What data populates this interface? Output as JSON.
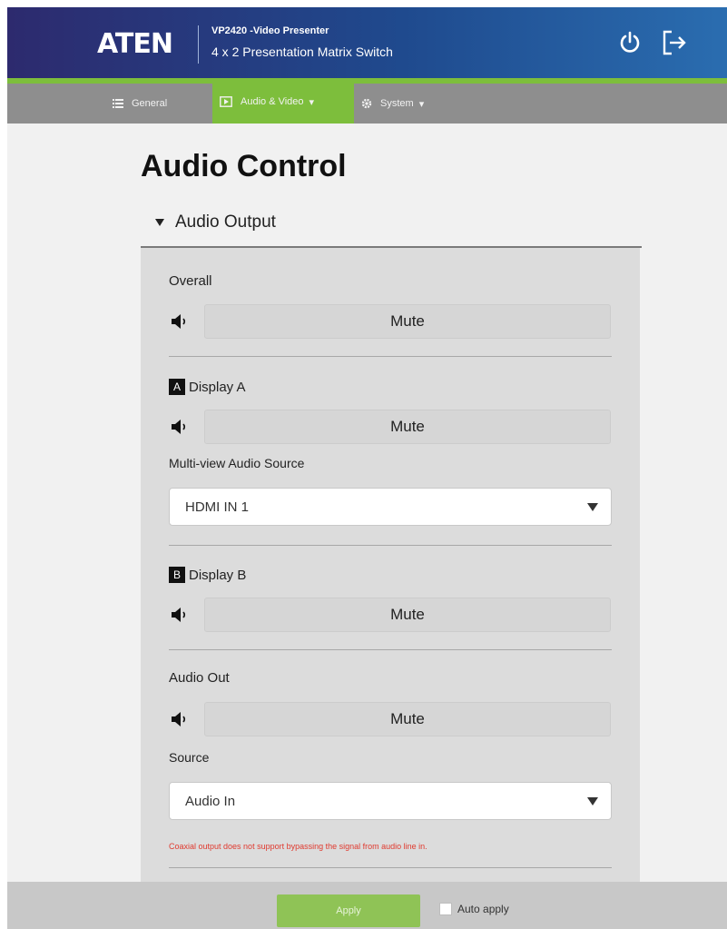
{
  "header": {
    "logo": "ATEN",
    "product_model": "VP2420 -Video Presenter",
    "product_desc": "4 x 2 Presentation Matrix Switch",
    "icons": {
      "power": "power-icon",
      "logout": "logout-icon"
    }
  },
  "nav": {
    "general": "General",
    "audio_video": "Audio & Video",
    "system": "System"
  },
  "page": {
    "title": "Audio Control"
  },
  "section": {
    "title": "Audio Output"
  },
  "groups": {
    "overall": {
      "label": "Overall",
      "mute": "Mute"
    },
    "display_a": {
      "badge": "A",
      "label": "Display A",
      "mute": "Mute",
      "source_label": "Multi-view Audio Source",
      "source_value": "HDMI IN 1"
    },
    "display_b": {
      "badge": "B",
      "label": "Display B",
      "mute": "Mute"
    },
    "audio_out": {
      "label": "Audio Out",
      "mute": "Mute",
      "source_label": "Source",
      "source_value": "Audio In"
    }
  },
  "warning": "Coaxial output does not support bypassing the signal from audio line in.",
  "footer": {
    "apply": "Apply",
    "auto_apply": "Auto apply"
  },
  "colors": {
    "accent_green": "#7dbe3c",
    "header_blue": "#1f4a8e",
    "warning_red": "#e03a2f"
  }
}
